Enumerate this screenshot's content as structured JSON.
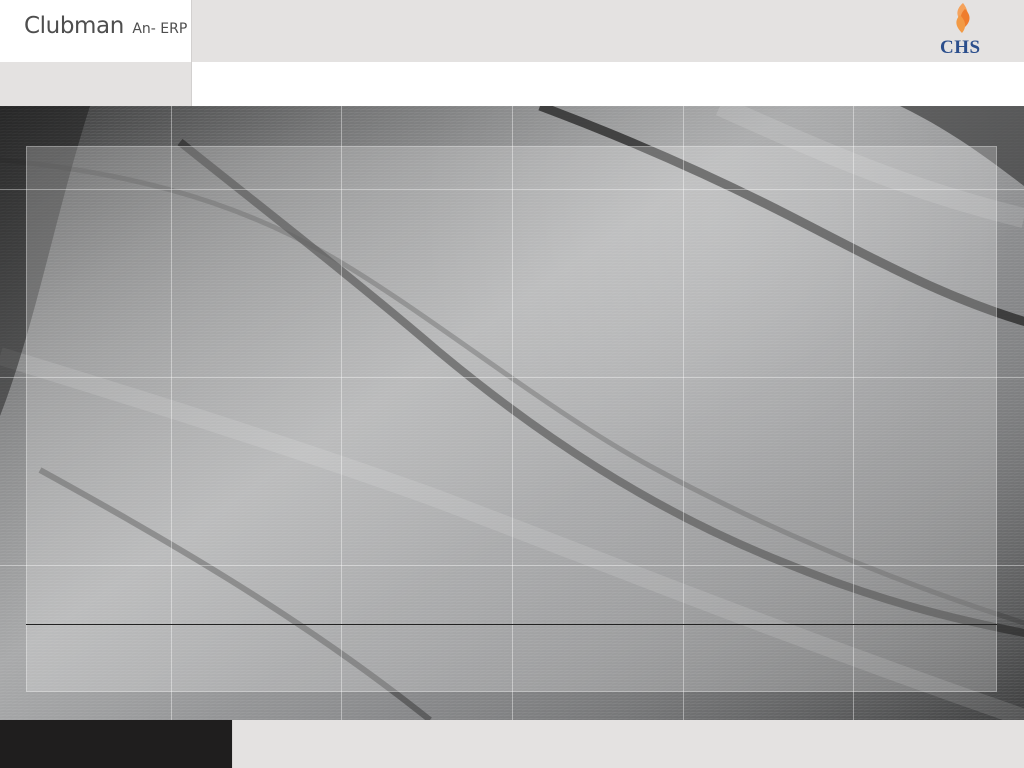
{
  "header": {
    "title_main": "Clubman",
    "title_sub": "An- ERP",
    "logo_text": "CHS"
  },
  "colors": {
    "header_band": "#e4e2e1",
    "footer_dark": "#1f1e1e",
    "logo_flame": "#f18a2c",
    "logo_text": "#2b4e8c"
  },
  "icons": {
    "logo": "chs-flame-logo"
  }
}
